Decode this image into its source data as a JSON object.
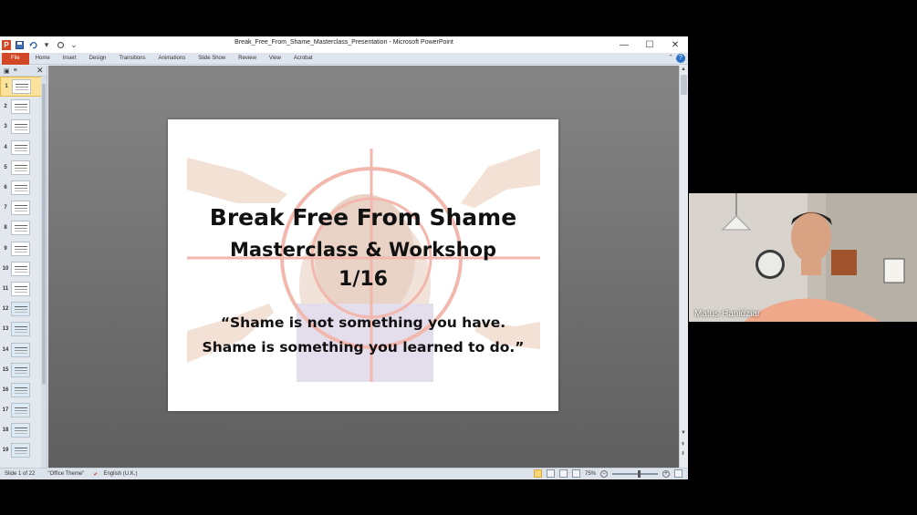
{
  "window": {
    "title": "Break_Free_From_Shame_Masterclass_Presentation - Microsoft PowerPoint",
    "app_icon": "P",
    "controls": [
      "minimize-icon",
      "maximize-icon",
      "close-icon"
    ]
  },
  "qat": [
    "save-icon",
    "undo-icon",
    "redo-icon",
    "customize-icon"
  ],
  "ribbon": {
    "tabs": [
      "File",
      "Home",
      "Insert",
      "Design",
      "Transitions",
      "Animations",
      "Slide Show",
      "Review",
      "View",
      "Acrobat"
    ],
    "help": "?"
  },
  "thumbnails": {
    "selected": 1,
    "numbers": [
      "1",
      "2",
      "3",
      "4",
      "5",
      "6",
      "7",
      "8",
      "9",
      "10",
      "11",
      "12",
      "13",
      "14",
      "15",
      "16",
      "17",
      "18",
      "19"
    ]
  },
  "slide": {
    "title": "Break Free From Shame",
    "subtitle": "Masterclass & Workshop",
    "count": "1/16",
    "quote_line1": "“Shame is not something you have.",
    "quote_line2": "Shame is something you learned to do.”"
  },
  "status": {
    "slide": "Slide 1 of 22",
    "theme": "\"Office Theme\"",
    "language": "English (U.K.)",
    "zoom": "75%",
    "zoom_level": 0.55
  },
  "video": {
    "participant": "Matus Hanidziar"
  },
  "colors": {
    "file_tab": "#d24726",
    "target": "#e8735f"
  }
}
